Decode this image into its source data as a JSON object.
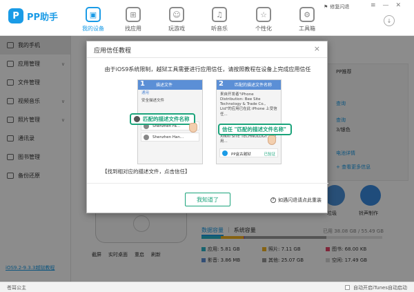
{
  "app": {
    "logo_mark": "P",
    "name": "PP助手"
  },
  "nav": {
    "tabs": [
      {
        "label": "我的设备",
        "icon": "device-icon",
        "glyph": "▣",
        "active": true
      },
      {
        "label": "找应用",
        "icon": "apps-icon",
        "glyph": "⊞"
      },
      {
        "label": "玩游戏",
        "icon": "gamepad-icon",
        "glyph": "☺"
      },
      {
        "label": "听音乐",
        "icon": "music-icon",
        "glyph": "♫"
      },
      {
        "label": "个性化",
        "icon": "star-icon",
        "glyph": "☆"
      },
      {
        "label": "工具箱",
        "icon": "toolbox-icon",
        "glyph": "⚙"
      }
    ],
    "fix_link": "修复闪退",
    "fix_icon_glyph": "⚑",
    "window_glyphs": [
      "≡",
      "—",
      "✕"
    ],
    "download_glyph": "↓"
  },
  "sidebar": {
    "items": [
      {
        "label": "我的手机",
        "active": true
      },
      {
        "label": "应用管理",
        "chevron": "∨"
      },
      {
        "label": "文件管理"
      },
      {
        "label": "视频音乐",
        "chevron": "∨"
      },
      {
        "label": "照片管理",
        "chevron": "∨"
      },
      {
        "label": "通讯录"
      },
      {
        "label": "图书管理"
      },
      {
        "label": "备份还原"
      }
    ],
    "footer_link": "iOS9.2-9.3.3越狱教程"
  },
  "main": {
    "phone_actions": [
      "截屏",
      "实时桌面",
      "重启",
      "刷新"
    ],
    "right_panel": {
      "title": "PP推荐",
      "lines": [
        {
          "text": "查询",
          "color": "blue"
        },
        {
          "text": "查询",
          "color": "blue"
        },
        {
          "text": "3/银色",
          "color": "dark"
        },
        {
          "text": "电池详情",
          "color": "blue"
        },
        {
          "text": "+ 查看更多信息",
          "color": "blue"
        }
      ]
    },
    "apps": [
      {
        "label": "垃圾",
        "color": "#4a90d9"
      },
      {
        "label": "铃声制作",
        "color": "#3a8be0"
      }
    ],
    "capacity": {
      "tab_data": "数据容量",
      "tab_sep": "|",
      "tab_system": "系统容量",
      "used_text": "已用 38.08 GB / 55.49 GB",
      "legend": [
        {
          "label": "应用: 5.81 GB",
          "color": "#2bb5c9"
        },
        {
          "label": "照片: 7.11 GB",
          "color": "#f3b322"
        },
        {
          "label": "图书: 68.00 KB",
          "color": "#e8456a"
        },
        {
          "label": "影音: 3.86 MB",
          "color": "#5b8fd6"
        },
        {
          "label": "其他: 25.07 GB",
          "color": "#9a9a9a"
        },
        {
          "label": "空闲: 17.49 GB",
          "color": "#d8d8d8"
        }
      ],
      "fractions": [
        0.105,
        0.128,
        0.001,
        0.001,
        0.452
      ]
    }
  },
  "dialog": {
    "title": "应用信任教程",
    "close_glyph": "×",
    "description": "由于iOS9系统限制，越狱工具需要进行应用信任，请按照教程在设备上完成应用信任",
    "step1": {
      "number": "1",
      "header": "描述文件",
      "back": "通用",
      "rows": [
        "安全描述文件",
        "Shenzhen Fa...",
        "Shenzhen Han..."
      ],
      "callout": "匹配的描述文件名称"
    },
    "step2": {
      "number": "2",
      "header": "匹配的描述文件名称",
      "text_top": "来自开发者\"iPhone Distribution: Bee Site Technology & Trade Co., Ltd\"的应用已在此 iPhone 上受信任...",
      "text_bottom": "来自开发者\"iPhone DISTRIBU... XINXI SITE TECHNOLOGY\"的应用...",
      "app_row": "PP盒古越狱",
      "verified": "已验证",
      "callout": "信任 \"匹配的描述文件名称\""
    },
    "caption": "【找到相对应的描述文件，点击信任】",
    "ok_button": "我知道了",
    "help_glyph": "?",
    "help_link": "如遇闪退请点此重装"
  },
  "statusbar": {
    "left": "苍耳公主",
    "right": "自动开启iTunes自动启动"
  }
}
